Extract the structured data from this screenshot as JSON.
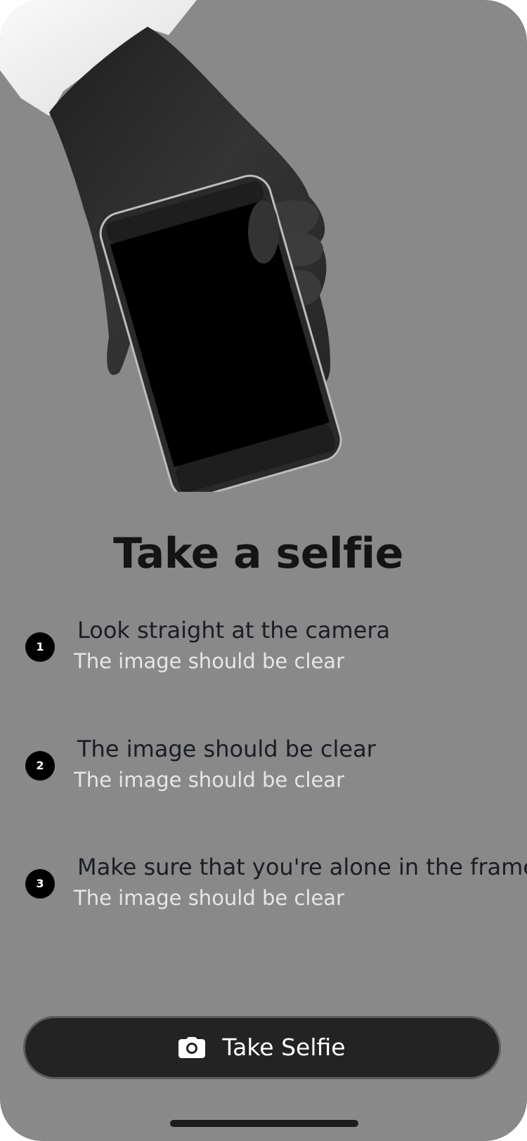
{
  "page": {
    "title": "Take a selfie",
    "hero_image": "hand-holding-phone-illustration"
  },
  "steps": [
    {
      "number": "1",
      "title": "Look straight at the camera",
      "subtitle": "The image should be clear"
    },
    {
      "number": "2",
      "title": "The image should be clear",
      "subtitle": "The image should be clear"
    },
    {
      "number": "3",
      "title": "Make sure that you're alone in the frame",
      "subtitle": "The image should be clear"
    }
  ],
  "action": {
    "label": "Take Selfie",
    "icon": "camera-icon"
  },
  "colors": {
    "background": "#898989",
    "button": "#232323",
    "title": "#141414",
    "step_title": "#1a1d24",
    "step_subtitle": "#e6e6e6"
  }
}
